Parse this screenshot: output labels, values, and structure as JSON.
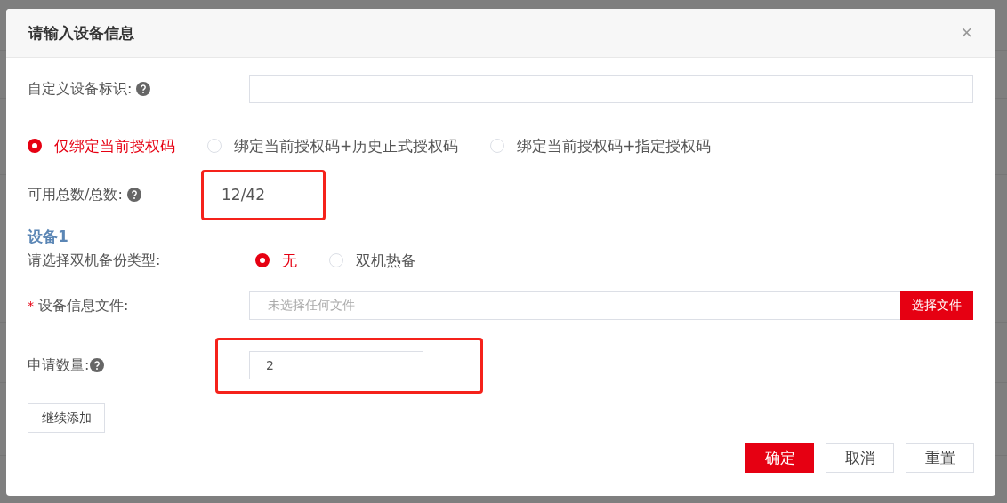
{
  "dialog": {
    "title": "请输入设备信息",
    "close_icon": "×"
  },
  "device_id": {
    "label": "自定义设备标识:"
  },
  "bind_options": [
    {
      "label": "仅绑定当前授权码",
      "selected": true
    },
    {
      "label": "绑定当前授权码+历史正式授权码",
      "selected": false
    },
    {
      "label": "绑定当前授权码+指定授权码",
      "selected": false
    }
  ],
  "count": {
    "label": "可用总数/总数:",
    "value": "12/42",
    "highlighted": true
  },
  "device": {
    "heading": "设备1",
    "backup_label": "请选择双机备份类型:",
    "backup_options": [
      {
        "label": "无",
        "selected": true
      },
      {
        "label": "双机热备",
        "selected": false
      }
    ],
    "file": {
      "required_mark": "*",
      "label": "设备信息文件:",
      "placeholder": "未选择任何文件",
      "button": "选择文件"
    },
    "quantity": {
      "label": "申请数量:",
      "value": "2",
      "highlighted": true
    }
  },
  "add_button": "继续添加",
  "footer_buttons": [
    {
      "label": "确定",
      "kind": "primary"
    },
    {
      "label": "取消",
      "kind": "default"
    },
    {
      "label": "重置",
      "kind": "default"
    }
  ]
}
